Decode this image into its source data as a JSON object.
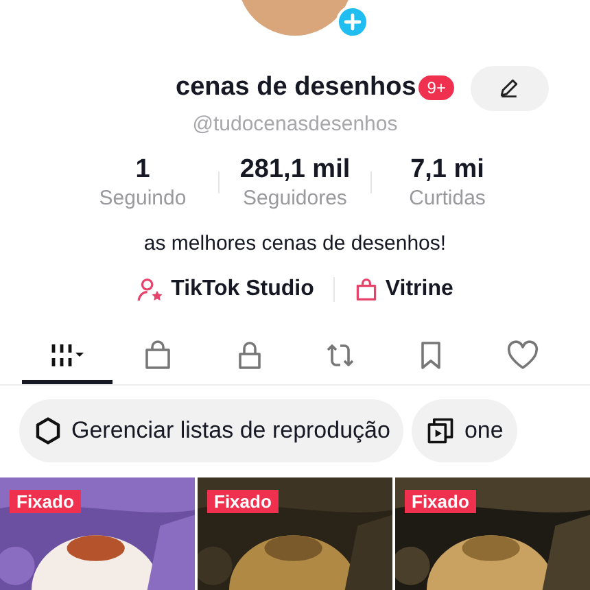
{
  "profile": {
    "name": "cenas de desenhos",
    "badge": "9+",
    "handle": "@tudocenasdesenhos"
  },
  "stats": [
    {
      "value": "1",
      "label": "Seguindo"
    },
    {
      "value": "281,1 mil",
      "label": "Seguidores"
    },
    {
      "value": "7,1 mi",
      "label": "Curtidas"
    }
  ],
  "bio": "as melhores cenas de desenhos!",
  "links": [
    {
      "kind": "studio",
      "label": "TikTok Studio"
    },
    {
      "kind": "shop",
      "label": "Vitrine"
    }
  ],
  "tabs": [
    {
      "kind": "grid",
      "selected": true
    },
    {
      "kind": "shop",
      "selected": false
    },
    {
      "kind": "lock",
      "selected": false
    },
    {
      "kind": "repost",
      "selected": false
    },
    {
      "kind": "bookmark",
      "selected": false
    },
    {
      "kind": "heart",
      "selected": false
    }
  ],
  "chips": [
    {
      "kind": "manage",
      "label": "Gerenciar listas de reprodução"
    },
    {
      "kind": "playlist",
      "label": "one"
    }
  ],
  "videos": [
    {
      "badge": "Fixado",
      "kind": "picture"
    },
    {
      "badge": "Fixado",
      "kind": "picture"
    },
    {
      "badge": "Fixado",
      "kind": "picture"
    }
  ]
}
